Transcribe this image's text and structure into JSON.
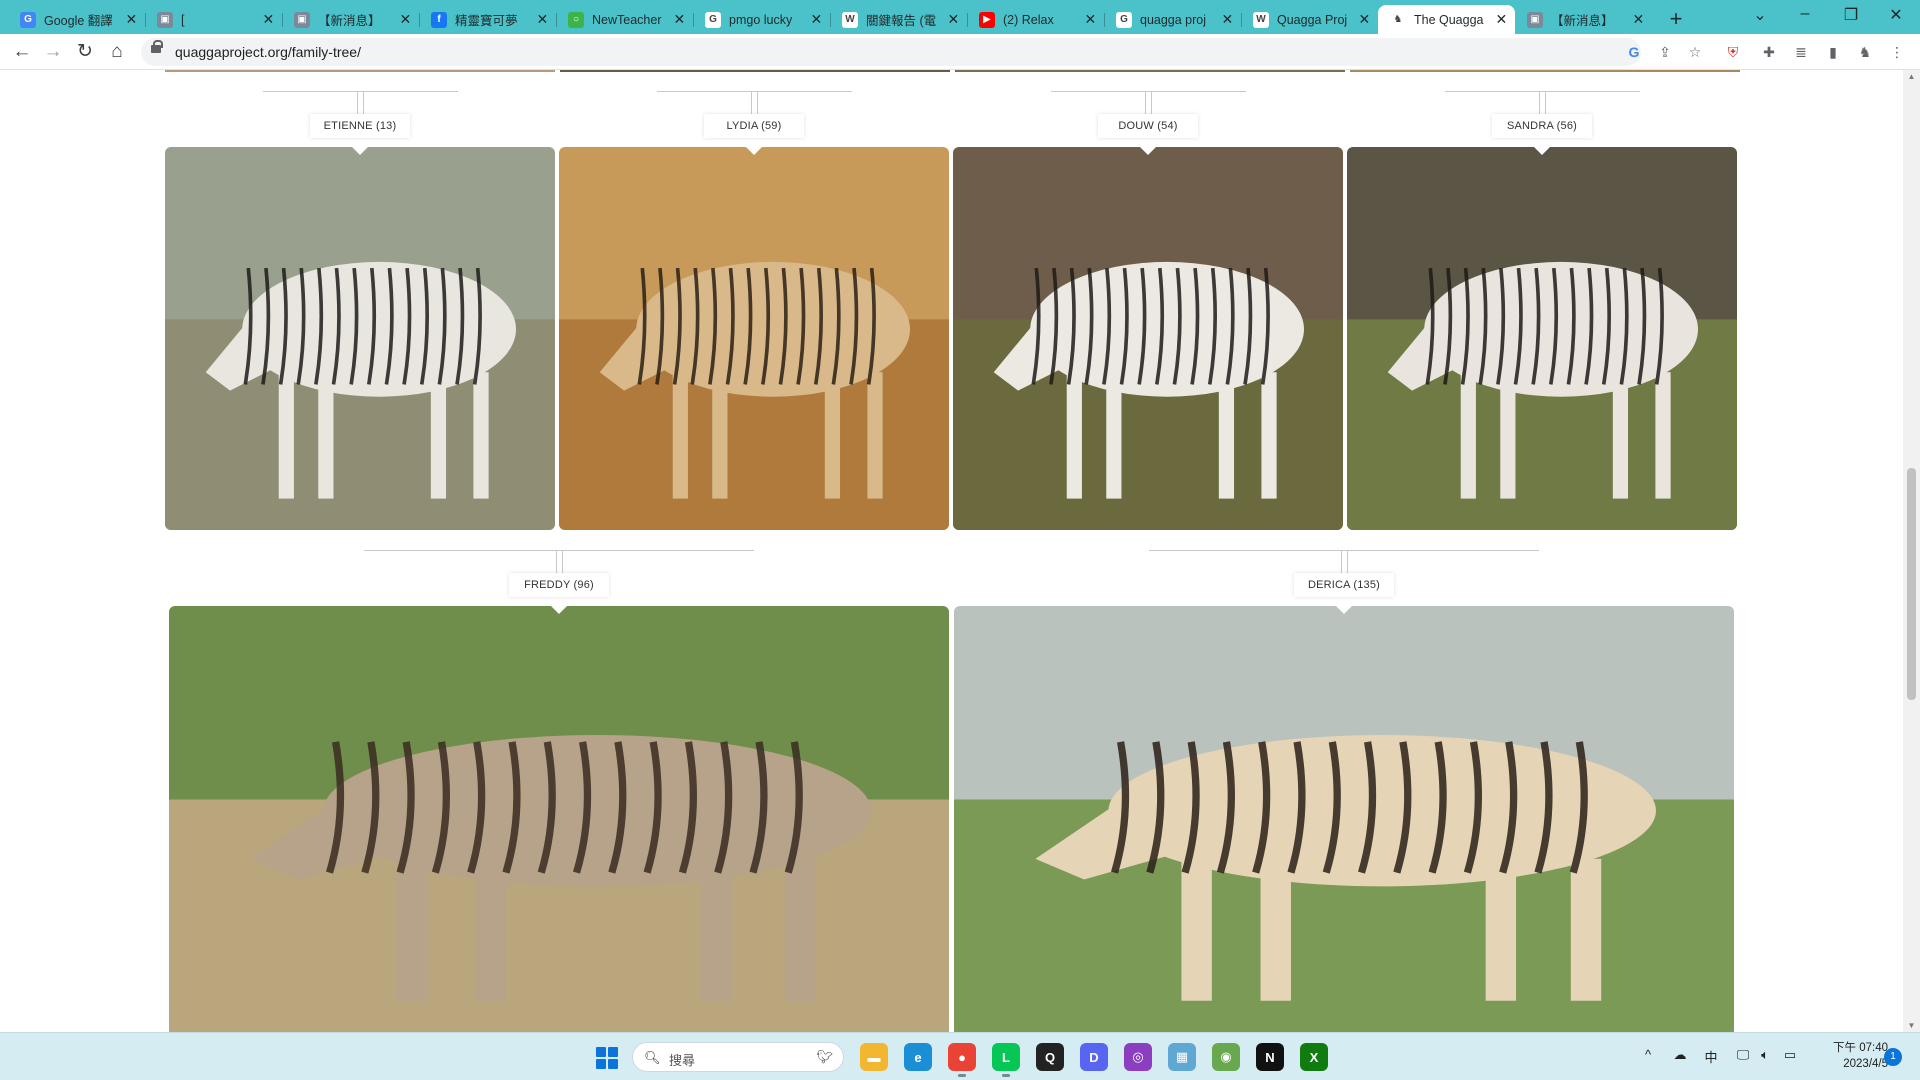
{
  "browser": {
    "tabs": [
      {
        "title": "Google 翻譯",
        "icon_color": "#4285f4",
        "icon_glyph": "G"
      },
      {
        "title": "[",
        "icon_color": "#7b8a9a",
        "icon_glyph": "▣"
      },
      {
        "title": "【新消息】",
        "icon_color": "#7b8a9a",
        "icon_glyph": "▣"
      },
      {
        "title": "精靈寶可夢",
        "icon_color": "#1877f2",
        "icon_glyph": "f"
      },
      {
        "title": "NewTeacher",
        "icon_color": "#3bb54a",
        "icon_glyph": "○"
      },
      {
        "title": "pmgo lucky",
        "icon_color": "#ffffff",
        "icon_glyph": "G"
      },
      {
        "title": "關鍵報告 (電",
        "icon_color": "#ffffff",
        "icon_glyph": "W"
      },
      {
        "title": "(2) Relax",
        "icon_color": "#ff0000",
        "icon_glyph": "▶"
      },
      {
        "title": "quagga proj",
        "icon_color": "#ffffff",
        "icon_glyph": "G"
      },
      {
        "title": "Quagga Proj",
        "icon_color": "#ffffff",
        "icon_glyph": "W"
      },
      {
        "title": "The Quagga",
        "icon_color": "#ffffff",
        "icon_glyph": "♞",
        "active": true
      },
      {
        "title": "【新消息】",
        "icon_color": "#7b8a9a",
        "icon_glyph": "▣"
      }
    ],
    "url": "quaggaproject.org/family-tree/"
  },
  "family_tree": {
    "row1": [
      {
        "label": "ETIENNE (13)",
        "sky": "#9aa08e",
        "ground": "#8f8d74",
        "body": "#e8e6df",
        "stripe": "#1c1b1a"
      },
      {
        "label": "LYDIA (59)",
        "sky": "#c89a5a",
        "ground": "#b07a3c",
        "body": "#d9b98a",
        "stripe": "#2a1e14"
      },
      {
        "label": "DOUW (54)",
        "sky": "#6e5d4a",
        "ground": "#6a6a3e",
        "body": "#ece8e2",
        "stripe": "#1e1a18"
      },
      {
        "label": "SANDRA (56)",
        "sky": "#5b5545",
        "ground": "#6f7a45",
        "body": "#e9e4dd",
        "stripe": "#1e1a18"
      }
    ],
    "row2": [
      {
        "label": "FREDDY (96)",
        "sky": "#6f8e4c",
        "ground": "#b9a67d",
        "body": "#b7a38a",
        "stripe": "#3a2b20"
      },
      {
        "label": "DERICA (135)",
        "sky": "#b9c2bd",
        "ground": "#7a9a55",
        "body": "#e6d4b6",
        "stripe": "#2a1f17"
      }
    ]
  },
  "taskbar": {
    "search_placeholder": "搜尋",
    "apps": [
      {
        "name": "file-explorer",
        "color": "#f2b730",
        "glyph": "▬"
      },
      {
        "name": "edge",
        "color": "#1a8fd6",
        "glyph": "e"
      },
      {
        "name": "chrome",
        "color": "#ea4335",
        "glyph": "●",
        "running": true
      },
      {
        "name": "line",
        "color": "#06c755",
        "glyph": "L",
        "running": true
      },
      {
        "name": "qq",
        "color": "#222222",
        "glyph": "Q"
      },
      {
        "name": "discord",
        "color": "#5865f2",
        "glyph": "D"
      },
      {
        "name": "app-purple",
        "color": "#8b3fc0",
        "glyph": "◎"
      },
      {
        "name": "app-screen",
        "color": "#5fa8d3",
        "glyph": "▦"
      },
      {
        "name": "app-globe",
        "color": "#6aa84f",
        "glyph": "◉"
      },
      {
        "name": "netflix",
        "color": "#111111",
        "glyph": "N"
      },
      {
        "name": "xbox",
        "color": "#107c10",
        "glyph": "X"
      }
    ],
    "ime_label": "中",
    "time": "下午 07:40",
    "date": "2023/4/5",
    "notification_count": "1"
  }
}
